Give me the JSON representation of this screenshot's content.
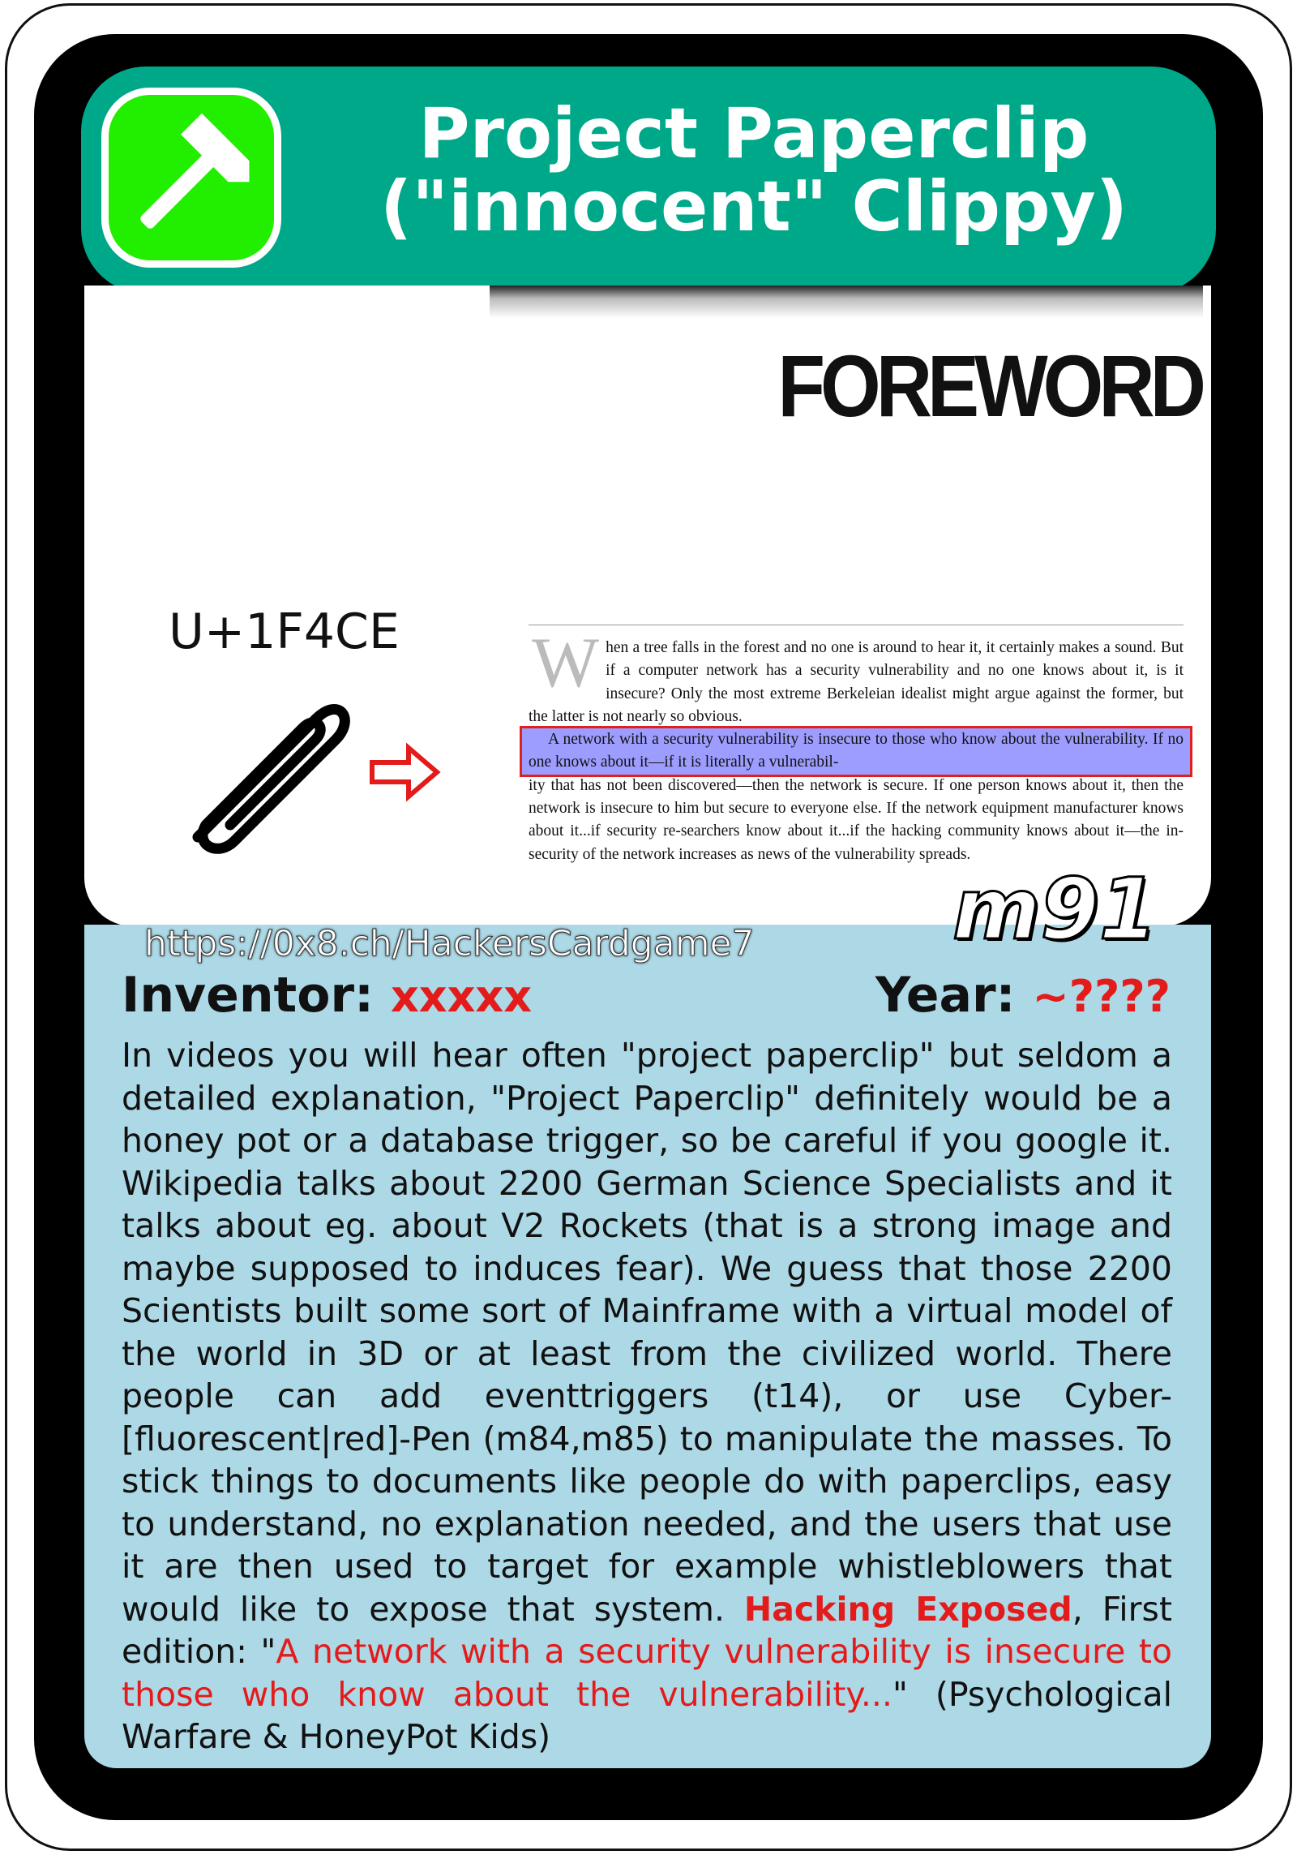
{
  "header": {
    "title_line1": "Project Paperclip",
    "title_line2": "(\"innocent\" Clippy)",
    "icon": "hammer-icon",
    "colors": {
      "banner": "#00a88a",
      "icon_bg": "#22ee00"
    }
  },
  "image": {
    "foreword_heading": "FOREWORD",
    "unicode_label": "U+1F4CE",
    "clip_icon": "paperclip-icon",
    "arrow_icon": "red-arrow-icon",
    "book": {
      "dropcap": "W",
      "para1": "hen a tree falls in the forest and no one is around to hear it, it certainly makes a sound. But if a computer network has a security vulnerability and no one knows about it, is it insecure? Only the most extreme Berkeleian idealist might argue against the former, but the latter is not nearly so obvious.",
      "para2_highlight": "A network with a security vulnerability is insecure to those who know about the vulnerability. If no one knows about it—if it is literally a vulnerabil-",
      "para2_rest": "ity that has not been discovered—then the network is secure. If one person knows about it, then the network is insecure to him but secure to everyone else. If the network equipment manufacturer knows about it...if security re-searchers know about it...if the hacking community knows about it—the in-security of the network increases as news of the vulnerability spreads."
    }
  },
  "footer": {
    "url": "https://0x8.ch/HackersCardgame7",
    "card_id": "m91"
  },
  "info": {
    "inventor_label": "Inventor:",
    "inventor_value": "xxxxx",
    "year_label": "Year:",
    "year_value": "~????"
  },
  "description": {
    "main": "In videos you will hear often \"project paperclip\" but seldom a detailed explanation, \"Project Paperclip\" definitely would be a honey pot or a database trigger, so be careful if you google it. Wikipedia talks about 2200 German Science Specialists and it talks about eg. about V2 Rockets (that is a strong image and maybe supposed to induces fear). We guess that those 2200 Scientists built some sort of Mainframe with a virtual model of the world in 3D or at least from the civilized world. There people can add eventtriggers (t14), or use Cyber-[fluorescent|red]-Pen (m84,m85) to manipulate the masses. To stick things to documents like people do with paperclips, easy to understand, no explanation needed, and the users that use it are then used to target for example whistleblowers that would like to expose that system.",
    "book_title": "Hacking Exposed",
    "edition_prefix": ", First edition: \"",
    "quote": "A network with a security vulnerability is insecure to those who know about the vulnerability...",
    "suffix": "\" (Psychological Warfare & HoneyPot Kids)"
  }
}
